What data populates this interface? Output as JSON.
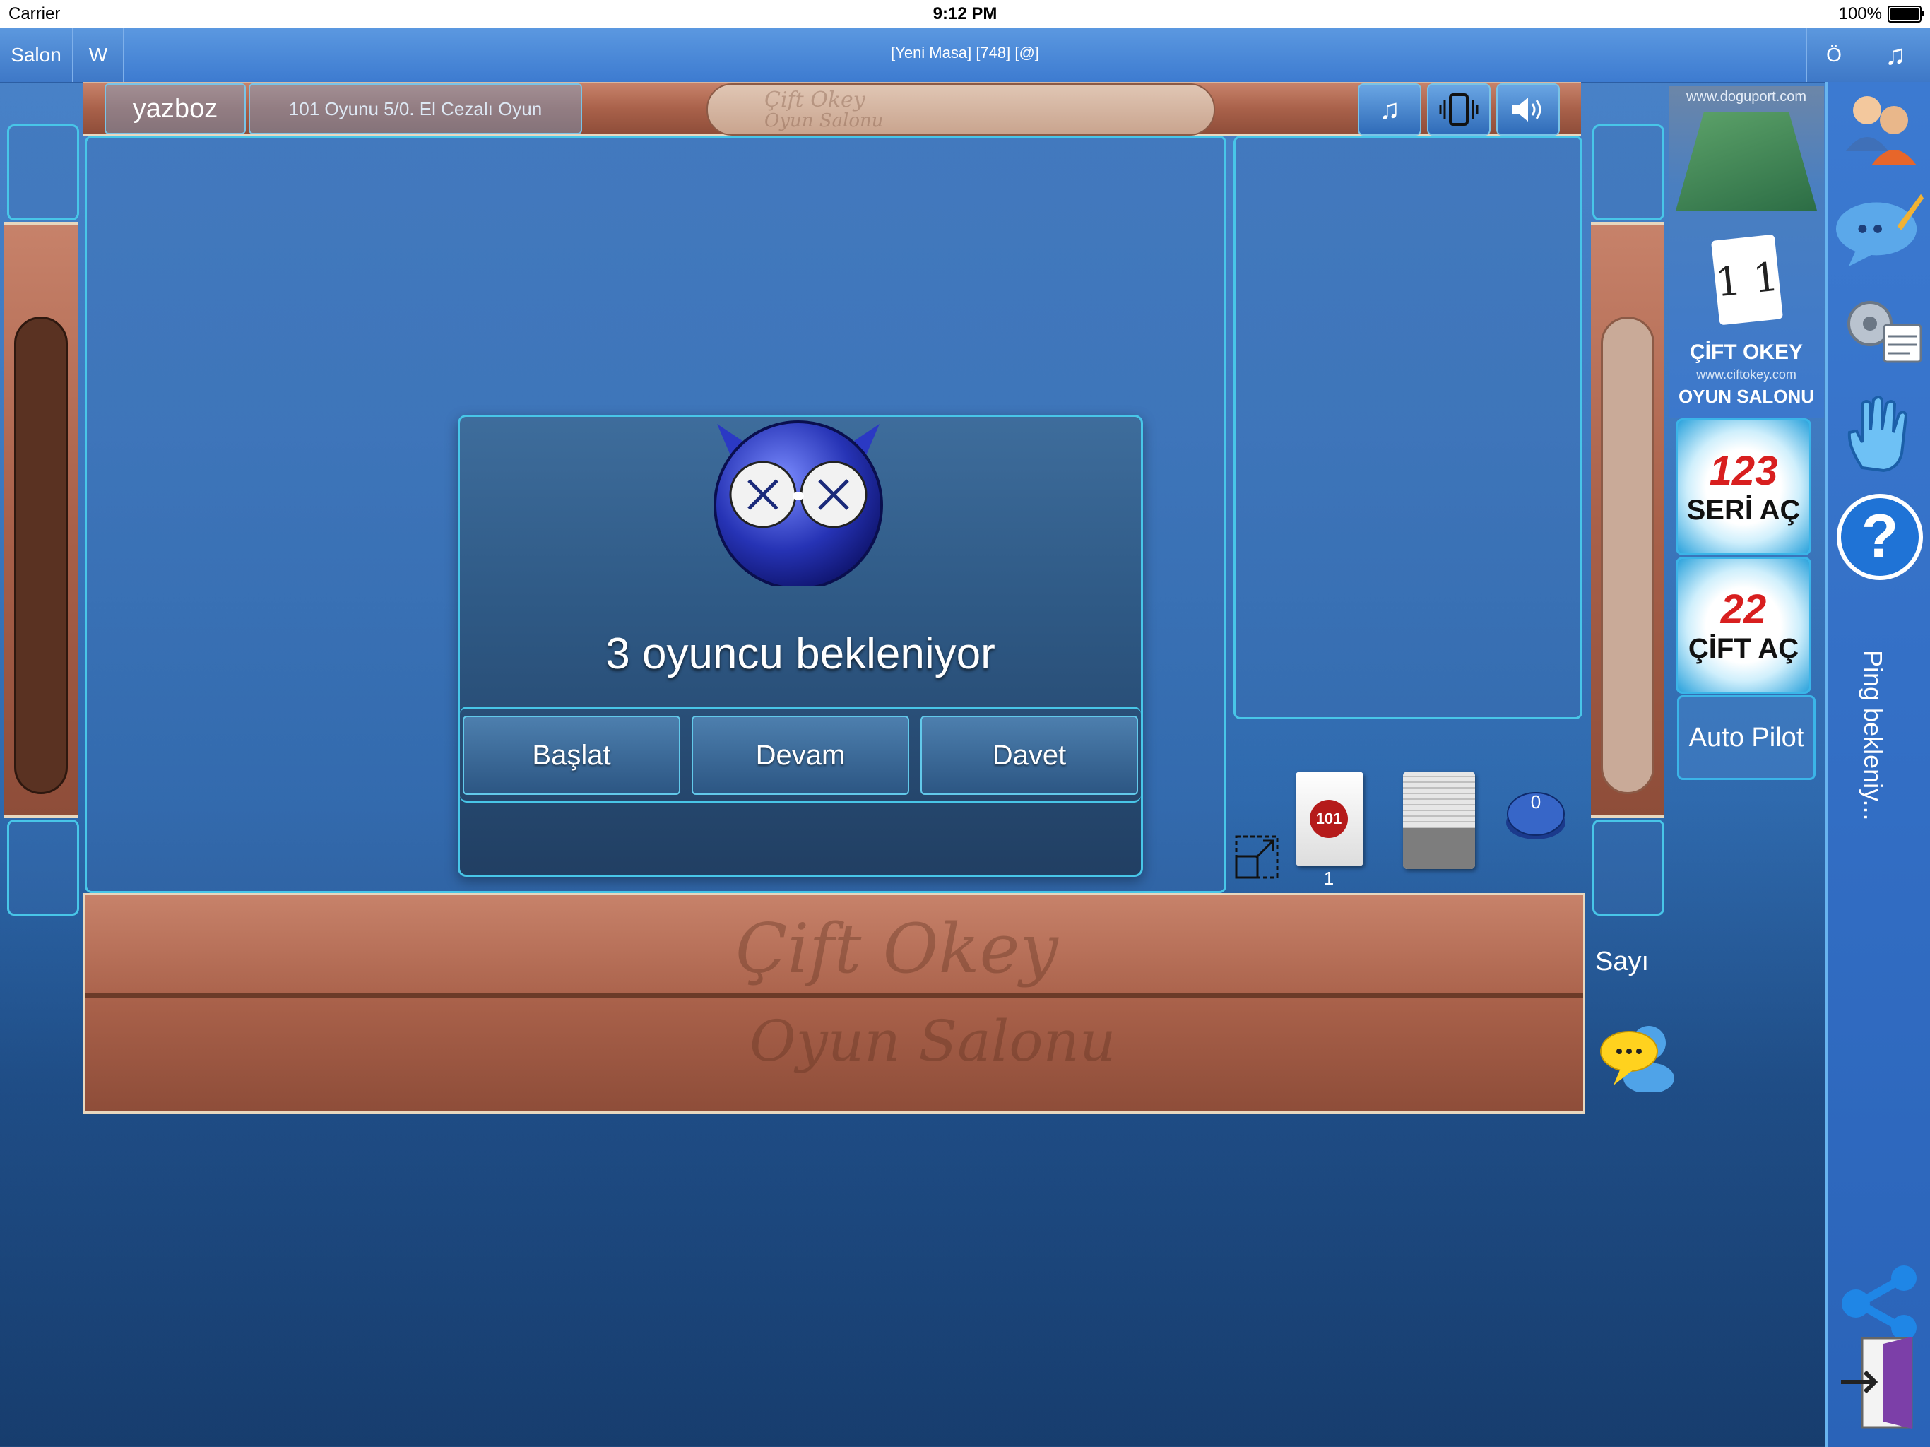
{
  "status_bar": {
    "carrier": "Carrier",
    "time": "9:12 PM",
    "battery": "100%"
  },
  "top_bar": {
    "salon_label": "Salon",
    "w_label": "W",
    "title": "[Yeni Masa] [748] [@]",
    "o_label": "Ö",
    "music_icon": "music-note-icon"
  },
  "table_header": {
    "player_name": "yazboz",
    "game_info": "101 Oyunu 5/0. El Cezalı Oyun",
    "logo_text_line1": "Çift Okey",
    "logo_text_line2": "Oyun Salonu",
    "icons": [
      "music-icon",
      "vibrate-icon",
      "speaker-icon"
    ]
  },
  "dialog": {
    "message": "3 oyuncu bekleniyor",
    "buttons": {
      "start": "Başlat",
      "continue": "Devam",
      "invite": "Davet"
    }
  },
  "right_table": {
    "tile_label": "101",
    "tile_count": "1",
    "counter": "0"
  },
  "rack": {
    "brand_line1": "Çift Okey",
    "brand_line2": "Oyun Salonu"
  },
  "side": {
    "sayi_label": "Sayı",
    "auto_pilot": "Auto Pilot"
  },
  "ads": {
    "site": "www.doguport.com",
    "brand_line1": "ÇİFT OKEY",
    "brand_url": "www.ciftokey.com",
    "brand_line2": "OYUN SALONU",
    "seri_num": "123",
    "seri_text": "SERİ AÇ",
    "cift_num": "22",
    "cift_text": "ÇİFT AÇ"
  },
  "sidebar": {
    "ping_text": "Ping bekleniy..."
  }
}
